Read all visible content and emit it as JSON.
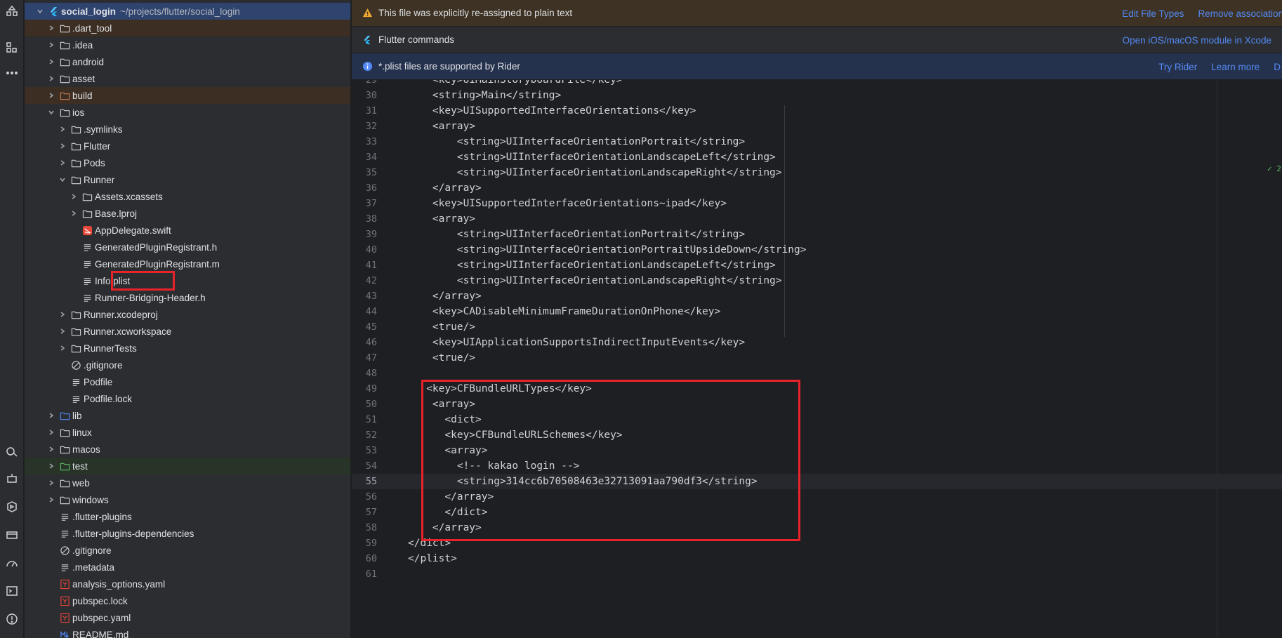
{
  "tool_stripe": {
    "icons": [
      "project-structure-icon",
      "components-icon",
      "more-icon",
      "flutter-inspector-icon",
      "robot-icon",
      "run-icon",
      "terminal-icon",
      "database-icon",
      "speedometer-icon",
      "console-icon",
      "problems-icon"
    ]
  },
  "project": {
    "root_name": "social_login",
    "root_path": "~/projects/flutter/social_login",
    "items": [
      {
        "label": "social_login",
        "depth": 0
      },
      {
        "label": ".dart_tool",
        "depth": 1
      },
      {
        "label": ".idea",
        "depth": 1
      },
      {
        "label": "android",
        "depth": 1
      },
      {
        "label": "asset",
        "depth": 1
      },
      {
        "label": "build",
        "depth": 1
      },
      {
        "label": "ios",
        "depth": 1
      },
      {
        "label": ".symlinks",
        "depth": 2
      },
      {
        "label": "Flutter",
        "depth": 2
      },
      {
        "label": "Pods",
        "depth": 2
      },
      {
        "label": "Runner",
        "depth": 2
      },
      {
        "label": "Assets.xcassets",
        "depth": 3
      },
      {
        "label": "Base.lproj",
        "depth": 3
      },
      {
        "label": "AppDelegate.swift",
        "depth": 3
      },
      {
        "label": "GeneratedPluginRegistrant.h",
        "depth": 3
      },
      {
        "label": "GeneratedPluginRegistrant.m",
        "depth": 3
      },
      {
        "label": "Info.plist",
        "depth": 3
      },
      {
        "label": "Runner-Bridging-Header.h",
        "depth": 3
      },
      {
        "label": "Runner.xcodeproj",
        "depth": 2
      },
      {
        "label": "Runner.xcworkspace",
        "depth": 2
      },
      {
        "label": "RunnerTests",
        "depth": 2
      },
      {
        "label": ".gitignore",
        "depth": 2
      },
      {
        "label": "Podfile",
        "depth": 2
      },
      {
        "label": "Podfile.lock",
        "depth": 2
      },
      {
        "label": "lib",
        "depth": 1
      },
      {
        "label": "linux",
        "depth": 1
      },
      {
        "label": "macos",
        "depth": 1
      },
      {
        "label": "test",
        "depth": 1
      },
      {
        "label": "web",
        "depth": 1
      },
      {
        "label": "windows",
        "depth": 1
      },
      {
        "label": ".flutter-plugins",
        "depth": 1
      },
      {
        "label": ".flutter-plugins-dependencies",
        "depth": 1
      },
      {
        "label": ".gitignore",
        "depth": 1
      },
      {
        "label": ".metadata",
        "depth": 1
      },
      {
        "label": "analysis_options.yaml",
        "depth": 1
      },
      {
        "label": "pubspec.lock",
        "depth": 1
      },
      {
        "label": "pubspec.yaml",
        "depth": 1
      },
      {
        "label": "README.md",
        "depth": 1
      }
    ]
  },
  "banners": {
    "warning": {
      "text": "This file was explicitly re-assigned to plain text",
      "link1": "Edit File Types",
      "link2": "Remove association"
    },
    "flutter": {
      "text": "Flutter commands",
      "link1": "Open iOS/macOS module in Xcode"
    },
    "info": {
      "text": "*.plist files are supported by Rider",
      "link1": "Try Rider",
      "link2": "Learn more",
      "link3": "D"
    }
  },
  "editor": {
    "current_line": "55",
    "inspection_badge": "✓ 2",
    "lines": [
      {
        "n": "29",
        "code": "    <key>UIMainStoryboardFile</key>"
      },
      {
        "n": "30",
        "code": "    <string>Main</string>"
      },
      {
        "n": "31",
        "code": "    <key>UISupportedInterfaceOrientations</key>"
      },
      {
        "n": "32",
        "code": "    <array>"
      },
      {
        "n": "33",
        "code": "        <string>UIInterfaceOrientationPortrait</string>"
      },
      {
        "n": "34",
        "code": "        <string>UIInterfaceOrientationLandscapeLeft</string>"
      },
      {
        "n": "35",
        "code": "        <string>UIInterfaceOrientationLandscapeRight</string>"
      },
      {
        "n": "36",
        "code": "    </array>"
      },
      {
        "n": "37",
        "code": "    <key>UISupportedInterfaceOrientations~ipad</key>"
      },
      {
        "n": "38",
        "code": "    <array>"
      },
      {
        "n": "39",
        "code": "        <string>UIInterfaceOrientationPortrait</string>"
      },
      {
        "n": "40",
        "code": "        <string>UIInterfaceOrientationPortraitUpsideDown</string>"
      },
      {
        "n": "41",
        "code": "        <string>UIInterfaceOrientationLandscapeLeft</string>"
      },
      {
        "n": "42",
        "code": "        <string>UIInterfaceOrientationLandscapeRight</string>"
      },
      {
        "n": "43",
        "code": "    </array>"
      },
      {
        "n": "44",
        "code": "    <key>CADisableMinimumFrameDurationOnPhone</key>"
      },
      {
        "n": "45",
        "code": "    <true/>"
      },
      {
        "n": "46",
        "code": "    <key>UIApplicationSupportsIndirectInputEvents</key>"
      },
      {
        "n": "47",
        "code": "    <true/>"
      },
      {
        "n": "48",
        "code": ""
      },
      {
        "n": "49",
        "code": "   <key>CFBundleURLTypes</key>"
      },
      {
        "n": "50",
        "code": "    <array>"
      },
      {
        "n": "51",
        "code": "      <dict>"
      },
      {
        "n": "52",
        "code": "      <key>CFBundleURLSchemes</key>"
      },
      {
        "n": "53",
        "code": "      <array>"
      },
      {
        "n": "54",
        "code": "        <!-- kakao login -->"
      },
      {
        "n": "55",
        "code": "        <string>314cc6b70508463e32713091aa790df3</string>"
      },
      {
        "n": "56",
        "code": "      </array>"
      },
      {
        "n": "57",
        "code": "      </dict>"
      },
      {
        "n": "58",
        "code": "    </array>"
      },
      {
        "n": "59",
        "code": "</dict>"
      },
      {
        "n": "60",
        "code": "</plist>"
      },
      {
        "n": "61",
        "code": ""
      }
    ]
  },
  "colors": {
    "highlight_box": "#e8232a",
    "link": "#548af7",
    "selection": "#2e436e"
  }
}
